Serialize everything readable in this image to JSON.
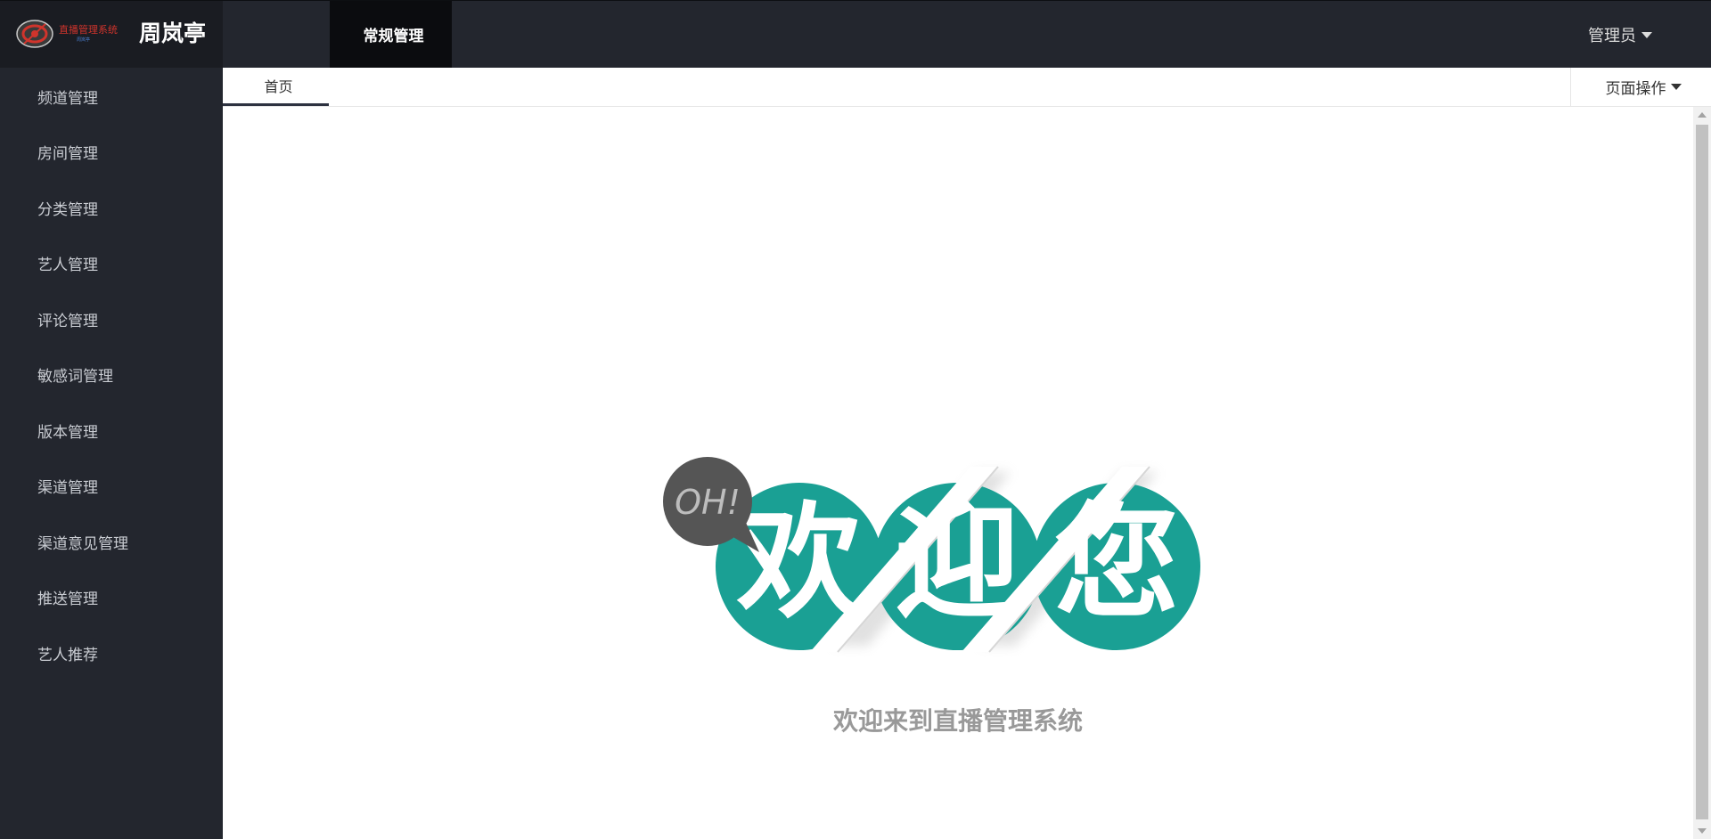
{
  "app": {
    "logo_text": "直播管理系统",
    "logo_subtext": "周岚亭",
    "brand_name": "周岚亭"
  },
  "topnav": {
    "toggle_icon": "",
    "active_item": {
      "icon": "",
      "label": "常规管理"
    },
    "user": {
      "name": "管理员"
    },
    "fullscreen_icon": ""
  },
  "sidebar": {
    "items": [
      {
        "icon": "",
        "label": "频道管理"
      },
      {
        "icon": "",
        "label": "房间管理"
      },
      {
        "icon": "",
        "label": "分类管理"
      },
      {
        "icon": "",
        "label": "艺人管理"
      },
      {
        "icon": "",
        "label": "评论管理"
      },
      {
        "icon": "",
        "label": "敏感词管理"
      },
      {
        "icon": "",
        "label": "版本管理"
      },
      {
        "icon": "",
        "label": "渠道管理"
      },
      {
        "icon": "",
        "label": "渠道意见管理"
      },
      {
        "icon": "",
        "label": "推送管理"
      },
      {
        "icon": "",
        "label": "艺人推荐"
      }
    ]
  },
  "tabs": {
    "home": {
      "icon": "",
      "label": "首页"
    },
    "page_ops": {
      "icon": "",
      "label": "页面操作"
    }
  },
  "welcome": {
    "bubble_text": "OH!",
    "chars": [
      "欢",
      "迎",
      "您"
    ],
    "message": "欢迎来到直播管理系统"
  },
  "colors": {
    "topbar": "#23262e",
    "logo_bg": "#1a1c22",
    "active_nav": "#0b0c0f",
    "accent": "#1aa094",
    "bubble": "#555555"
  }
}
